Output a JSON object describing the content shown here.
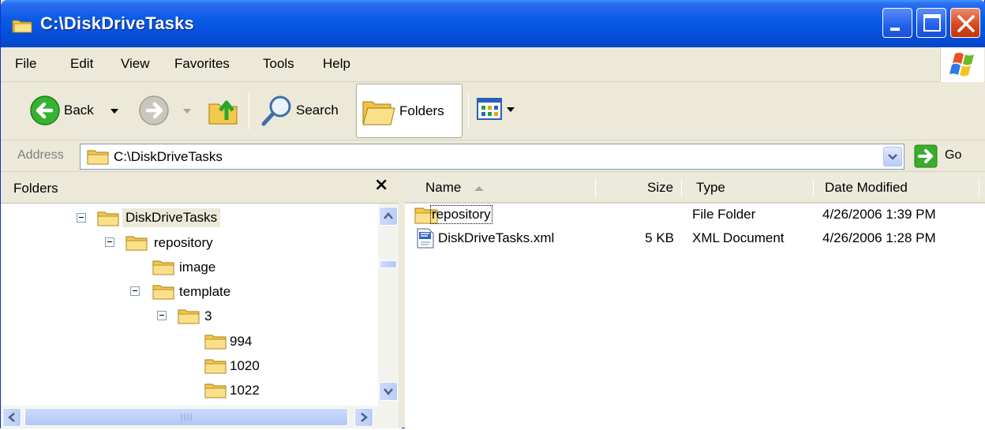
{
  "window": {
    "title": "C:\\DiskDriveTasks"
  },
  "menu": [
    "File",
    "Edit",
    "View",
    "Favorites",
    "Tools",
    "Help"
  ],
  "toolbar": {
    "back": "Back",
    "search": "Search",
    "folders": "Folders"
  },
  "address": {
    "label": "Address",
    "value": "C:\\DiskDriveTasks",
    "go": "Go"
  },
  "folders_pane": {
    "title": "Folders",
    "close": "×",
    "tree": [
      {
        "label": "DiskDriveTasks",
        "expander": true,
        "selected": true
      },
      {
        "label": "repository",
        "expander": true
      },
      {
        "label": "image",
        "expander": false
      },
      {
        "label": "template",
        "expander": true
      },
      {
        "label": "3",
        "expander": true
      },
      {
        "label": "994",
        "expander": false
      },
      {
        "label": "1020",
        "expander": false
      },
      {
        "label": "1022",
        "expander": false
      }
    ]
  },
  "filelist": {
    "columns": [
      "Name",
      "Size",
      "Type",
      "Date Modified"
    ],
    "rows": [
      {
        "name": "repository",
        "size": "",
        "type": "File Folder",
        "date": "4/26/2006 1:39 PM",
        "icon": "folder-icon"
      },
      {
        "name": "DiskDriveTasks.xml",
        "size": "5 KB",
        "type": "XML Document",
        "date": "4/26/2006 1:28 PM",
        "icon": "xml-document-icon"
      }
    ]
  },
  "colors": {
    "titlebar": "#0a5be6",
    "chrome": "#ece9d8",
    "folder": "#f6d46a"
  }
}
